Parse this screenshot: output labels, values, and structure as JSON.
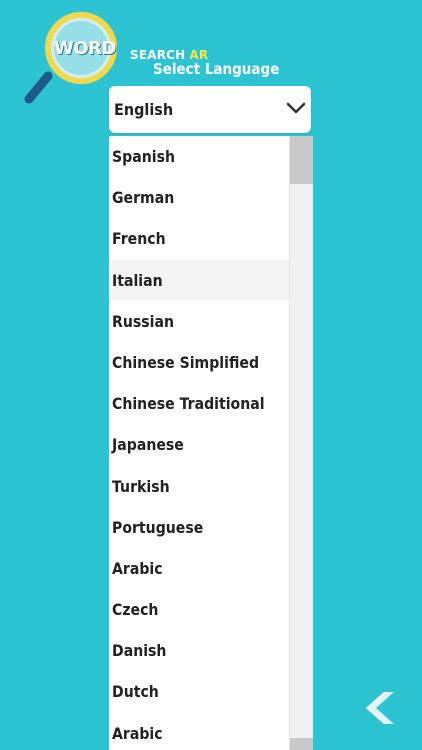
{
  "logo": {
    "word": "WORD",
    "search": "SEARCH",
    "ar": "AR"
  },
  "title": "Select Language",
  "select": {
    "value": "English",
    "chevron_icon": "chevron-down-icon"
  },
  "languages": [
    "Spanish",
    "German",
    "French",
    "Italian",
    "Russian",
    "Chinese Simplified",
    "Chinese Traditional",
    "Japanese",
    "Turkish",
    "Portuguese",
    "Arabic",
    "Czech",
    "Danish",
    "Dutch",
    "Arabic"
  ],
  "highlighted_index": 3,
  "back_icon": "chevron-left-icon",
  "colors": {
    "background": "#2cc4d3",
    "logo_accent": "#f6e64a",
    "handle": "#1d5b8c"
  }
}
